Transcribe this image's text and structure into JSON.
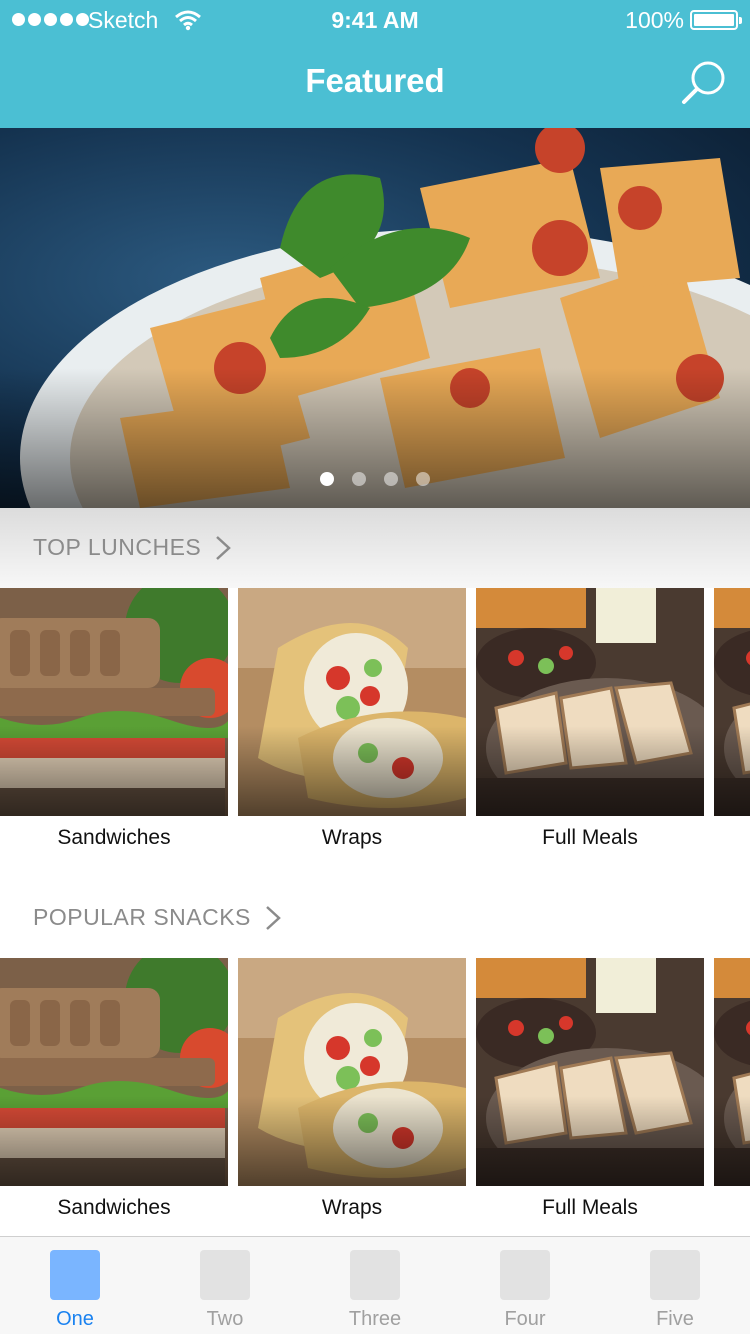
{
  "status_bar": {
    "carrier": "Sketch",
    "time": "9:41 AM",
    "battery": "100%"
  },
  "nav": {
    "title": "Featured"
  },
  "hero": {
    "page_count": 4,
    "active_page": 1
  },
  "sections": [
    {
      "title": "TOP LUNCHES",
      "items": [
        {
          "label": "Sandwiches"
        },
        {
          "label": "Wraps"
        },
        {
          "label": "Full Meals"
        }
      ]
    },
    {
      "title": "POPULAR SNACKS",
      "items": [
        {
          "label": "Sandwiches"
        },
        {
          "label": "Wraps"
        },
        {
          "label": "Full Meals"
        }
      ]
    }
  ],
  "tabs": [
    {
      "label": "One",
      "active": true
    },
    {
      "label": "Two",
      "active": false
    },
    {
      "label": "Three",
      "active": false
    },
    {
      "label": "Four",
      "active": false
    },
    {
      "label": "Five",
      "active": false
    }
  ],
  "colors": {
    "header": "#4bbfd3",
    "tab_active": "#1a82f0",
    "tab_active_icon": "#7ab5ff"
  }
}
